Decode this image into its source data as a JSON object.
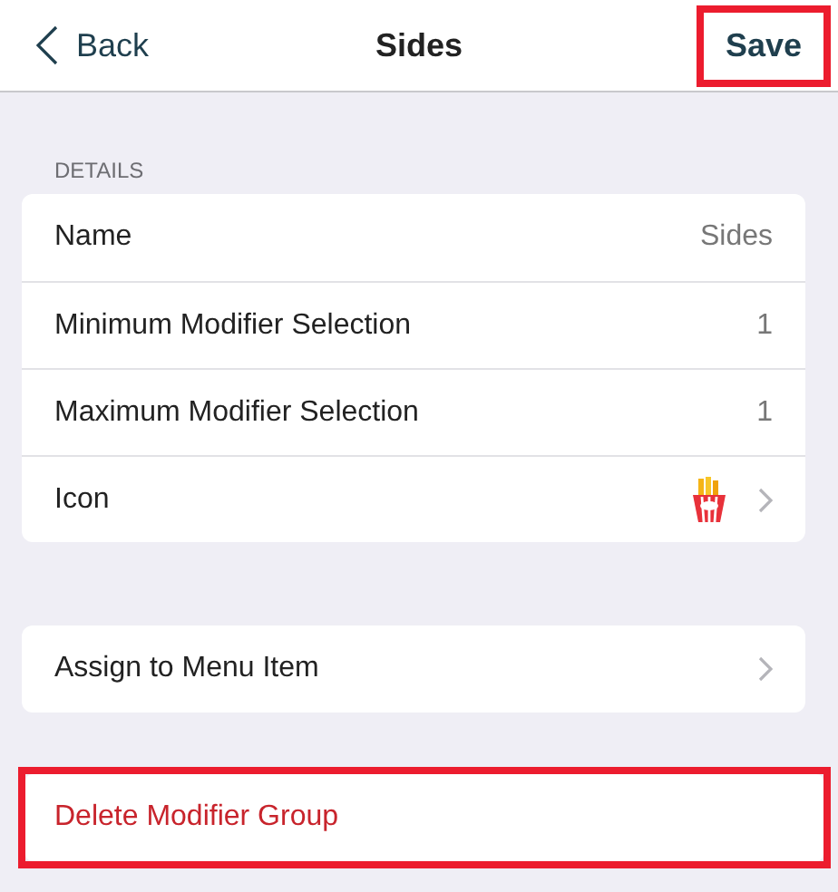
{
  "nav": {
    "back_label": "Back",
    "title": "Sides",
    "save": {
      "label": "Save",
      "highlighted": true
    }
  },
  "details": {
    "heading": "DETAILS",
    "rows": [
      {
        "kind": "value",
        "label": "Name",
        "value": "Sides"
      },
      {
        "kind": "value",
        "label": "Minimum Modifier Selection",
        "value": "1"
      },
      {
        "kind": "value",
        "label": "Maximum Modifier Selection",
        "value": "1"
      },
      {
        "kind": "icon",
        "label": "Icon"
      }
    ]
  },
  "assign": {
    "label": "Assign to Menu Item"
  },
  "delete": {
    "label": "Delete Modifier Group",
    "highlighted": true
  }
}
